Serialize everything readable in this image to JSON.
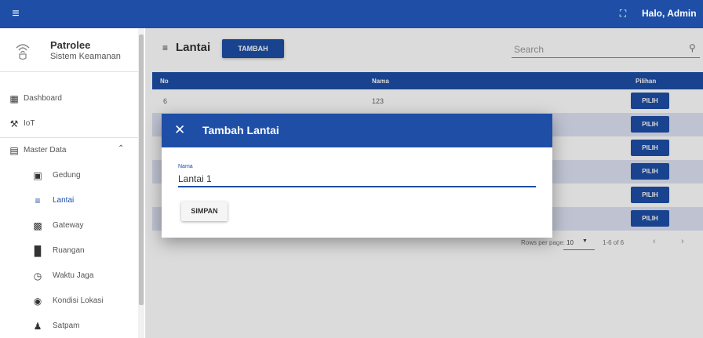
{
  "header": {
    "menu_icon": "menu-icon",
    "fullscreen_icon": "fullscreen-icon",
    "greeting": "Halo, Admin",
    "color": "#1e4ea6"
  },
  "sidebar": {
    "brand_name": "Patrolee",
    "brand_sub": "Sistem Keamanan",
    "brand_icon": "wifi-shield-icon",
    "items": [
      {
        "label": "Dashboard",
        "icon": "dashboard-icon"
      },
      {
        "label": "IoT",
        "icon": "wrench-icon"
      },
      {
        "label": "Master Data",
        "icon": "table-icon",
        "expanded": true
      },
      {
        "label": "Gedung",
        "icon": "building-icon"
      },
      {
        "label": "Lantai",
        "icon": "list-icon",
        "active": true
      },
      {
        "label": "Gateway",
        "icon": "router-icon"
      },
      {
        "label": "Ruangan",
        "icon": "room-icon"
      },
      {
        "label": "Waktu Jaga",
        "icon": "clock-icon"
      },
      {
        "label": "Kondisi Lokasi",
        "icon": "radio-icon"
      },
      {
        "label": "Satpam",
        "icon": "person-icon"
      }
    ]
  },
  "main": {
    "title": "Lantai",
    "add_button": "TAMBAH",
    "search_placeholder": "Search",
    "table": {
      "headers": [
        "No",
        "Nama",
        "Pilihan"
      ],
      "rows": [
        {
          "no": "6",
          "nama": "123"
        },
        {
          "no": "",
          "nama": ""
        },
        {
          "no": "",
          "nama": ""
        },
        {
          "no": "",
          "nama": ""
        },
        {
          "no": "",
          "nama": ""
        },
        {
          "no": "",
          "nama": ""
        }
      ],
      "action_label": "PILIH"
    },
    "pagination": {
      "rows_per_page_label": "Rows per page:",
      "rows_per_page_value": "10",
      "range": "1-6 of 6"
    }
  },
  "dialog": {
    "title": "Tambah Lantai",
    "field_label": "Nama",
    "field_value": "Lantai 1",
    "save_button": "SIMPAN"
  }
}
